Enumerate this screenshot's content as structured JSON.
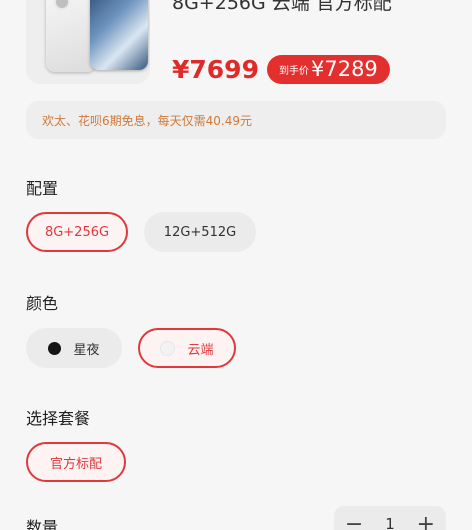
{
  "product": {
    "title": "8G+256G 云端 官方标配",
    "price": "¥7699",
    "deal_label": "到手价",
    "deal_price": "¥7289",
    "installment_note": "欢太、花呗6期免息，每天仅需40.49元"
  },
  "config": {
    "label": "配置",
    "options": [
      "8G+256G",
      "12G+512G"
    ],
    "selected": "8G+256G"
  },
  "color": {
    "label": "颜色",
    "options": [
      "星夜",
      "云端"
    ],
    "selected": "云端"
  },
  "package": {
    "label": "选择套餐",
    "options": [
      "官方标配"
    ],
    "selected": "官方标配"
  },
  "quantity": {
    "label": "数量",
    "value": "1",
    "minus": "−",
    "plus": "+"
  },
  "colors": {
    "accent": "#e0393d",
    "installment_text": "#cf7a3a"
  }
}
